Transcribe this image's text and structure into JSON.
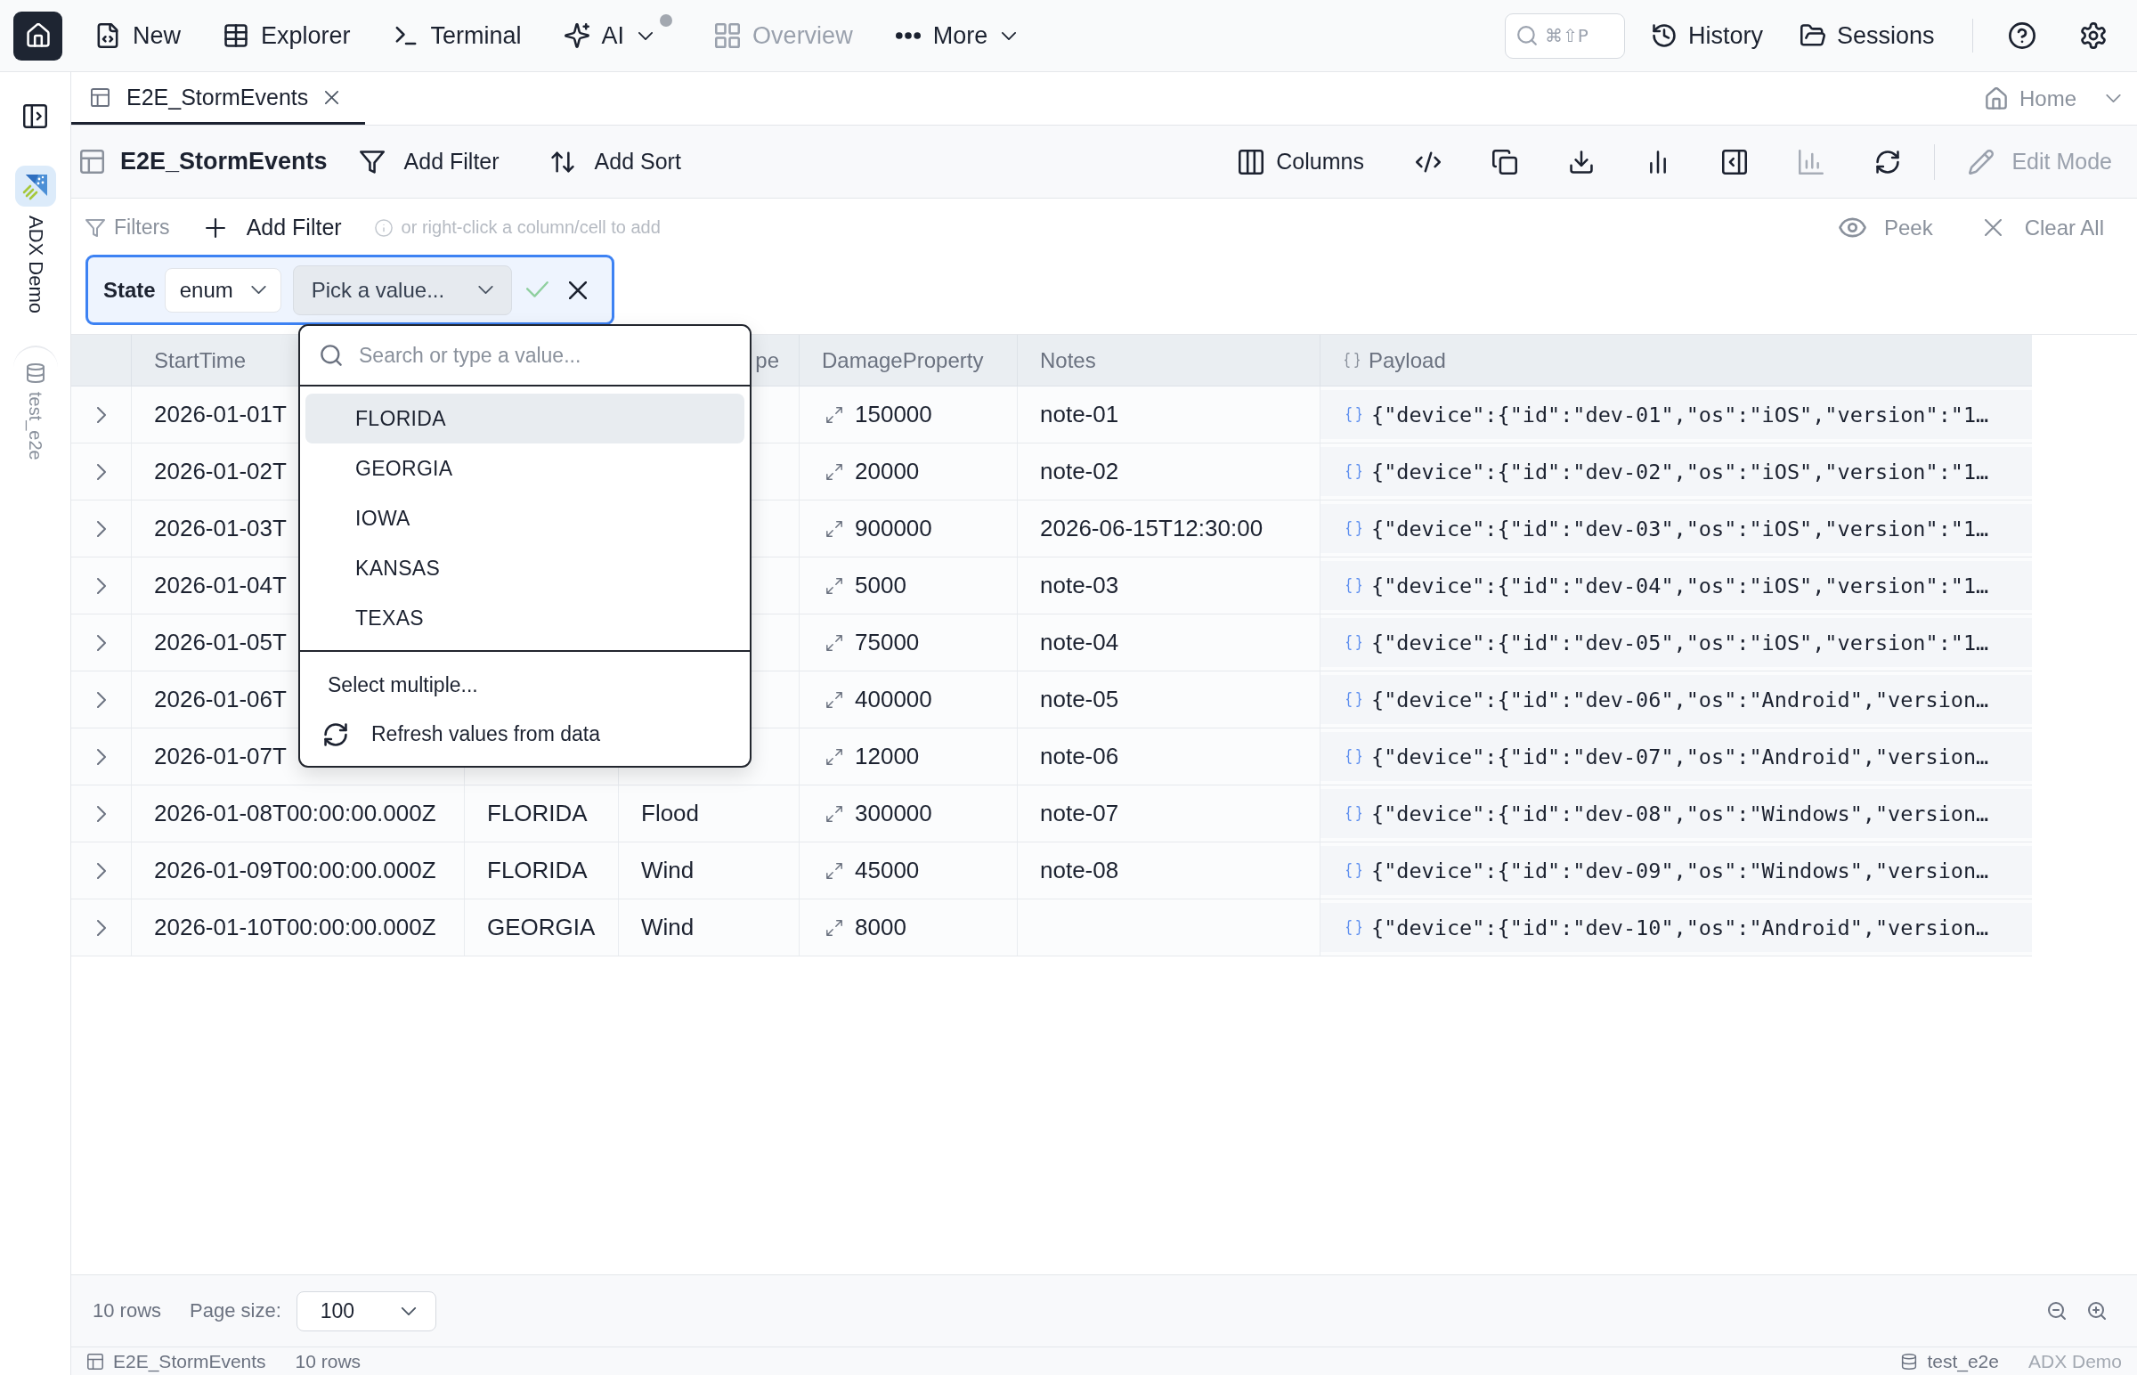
{
  "top_bar": {
    "nav": [
      {
        "label": "New",
        "dropdown": false,
        "disabled": false,
        "dot": false
      },
      {
        "label": "Explorer",
        "dropdown": false,
        "disabled": false,
        "dot": false
      },
      {
        "label": "Terminal",
        "dropdown": false,
        "disabled": false,
        "dot": false
      },
      {
        "label": "AI",
        "dropdown": true,
        "disabled": false,
        "dot": true
      },
      {
        "label": "Overview",
        "dropdown": false,
        "disabled": true,
        "dot": false
      },
      {
        "label": "More",
        "dropdown": true,
        "disabled": false,
        "dot": false
      }
    ],
    "search": {
      "shortcut": "⌘⇧P"
    },
    "links": [
      {
        "label": "History"
      },
      {
        "label": "Sessions"
      }
    ]
  },
  "sidebar": {
    "items": [
      {
        "label": "ADX Demo",
        "selected": true
      },
      {
        "label": "test_e2e",
        "selected": false
      }
    ]
  },
  "tabs": [
    {
      "label": "E2E_StormEvents",
      "selected": true
    }
  ],
  "home_link": {
    "label": "Home"
  },
  "toolbar": {
    "title": "E2E_StormEvents",
    "actions": [
      {
        "label": "Add Filter"
      },
      {
        "label": "Add Sort"
      }
    ],
    "columns_label": "Columns",
    "icon_buttons": [
      {
        "disabled": false
      },
      {
        "disabled": false
      },
      {
        "disabled": false
      },
      {
        "disabled": false
      },
      {
        "disabled": false
      },
      {
        "disabled": true
      },
      {
        "disabled": false
      }
    ],
    "edit_mode": {
      "label": "Edit Mode",
      "disabled": true
    }
  },
  "filters": {
    "label": "Filters",
    "add_label": "Add Filter",
    "hint": "or right-click a column/cell to add",
    "peek": "Peek",
    "clear_all": "Clear All",
    "chips": [
      {
        "field": "State",
        "type": "enum",
        "value_placeholder": "Pick a value..."
      }
    ],
    "value_dropdown": {
      "placeholder": "Search or type a value...",
      "options": [
        {
          "label": "FLORIDA",
          "selected": true
        },
        {
          "label": "GEORGIA",
          "selected": false
        },
        {
          "label": "IOWA",
          "selected": false
        },
        {
          "label": "KANSAS",
          "selected": false
        },
        {
          "label": "TEXAS",
          "selected": false
        }
      ],
      "select_multiple": "Select multiple...",
      "refresh": "Refresh values from data"
    }
  },
  "table": {
    "columns": [
      {
        "kind": "plain",
        "label": "StartTime"
      },
      {
        "kind": "plain"
      },
      {
        "kind": "plain",
        "label": "pe"
      },
      {
        "kind": "number",
        "label": "DamageProperty"
      },
      {
        "kind": "plain",
        "label": "Notes"
      },
      {
        "kind": "json",
        "label": "Payload"
      }
    ],
    "rows": [
      {
        "expanded": false,
        "start_time": "2026-01-01T",
        "damage_property": "150000",
        "notes": "note-01",
        "payload": "{\"device\":{\"id\":\"dev-01\",\"os\":\"iOS\",\"version\":\"1…"
      },
      {
        "expanded": false,
        "start_time": "2026-01-02T",
        "damage_property": "20000",
        "notes": "note-02",
        "payload": "{\"device\":{\"id\":\"dev-02\",\"os\":\"iOS\",\"version\":\"1…"
      },
      {
        "expanded": false,
        "start_time": "2026-01-03T",
        "damage_property": "900000",
        "notes": "2026-06-15T12:30:00",
        "payload": "{\"device\":{\"id\":\"dev-03\",\"os\":\"iOS\",\"version\":\"1…"
      },
      {
        "expanded": false,
        "start_time": "2026-01-04T",
        "damage_property": "5000",
        "notes": "note-03",
        "payload": "{\"device\":{\"id\":\"dev-04\",\"os\":\"iOS\",\"version\":\"1…"
      },
      {
        "expanded": false,
        "start_time": "2026-01-05T",
        "damage_property": "75000",
        "notes": "note-04",
        "payload": "{\"device\":{\"id\":\"dev-05\",\"os\":\"iOS\",\"version\":\"1…"
      },
      {
        "expanded": false,
        "start_time": "2026-01-06T",
        "damage_property": "400000",
        "notes": "note-05",
        "payload": "{\"device\":{\"id\":\"dev-06\",\"os\":\"Android\",\"version…"
      },
      {
        "expanded": false,
        "start_time": "2026-01-07T",
        "damage_property": "12000",
        "notes": "note-06",
        "payload": "{\"device\":{\"id\":\"dev-07\",\"os\":\"Android\",\"version…"
      },
      {
        "expanded": false,
        "start_time": "2026-01-08T00:00:00.000Z",
        "state": "FLORIDA",
        "event_type": "Flood",
        "damage_property": "300000",
        "notes": "note-07",
        "payload": "{\"device\":{\"id\":\"dev-08\",\"os\":\"Windows\",\"version…"
      },
      {
        "expanded": false,
        "start_time": "2026-01-09T00:00:00.000Z",
        "state": "FLORIDA",
        "event_type": "Wind",
        "damage_property": "45000",
        "notes": "note-08",
        "payload": "{\"device\":{\"id\":\"dev-09\",\"os\":\"Windows\",\"version…"
      },
      {
        "expanded": false,
        "start_time": "2026-01-10T00:00:00.000Z",
        "state": "GEORGIA",
        "event_type": "Wind",
        "damage_property": "8000",
        "payload": "{\"device\":{\"id\":\"dev-10\",\"os\":\"Android\",\"version…"
      }
    ]
  },
  "footer": {
    "row_count": "10 rows",
    "page_size_label": "Page size:",
    "page_size": "100"
  },
  "status_bar": {
    "table": "E2E_StormEvents",
    "row_count": "10 rows",
    "database": "test_e2e",
    "cluster": "ADX Demo"
  }
}
